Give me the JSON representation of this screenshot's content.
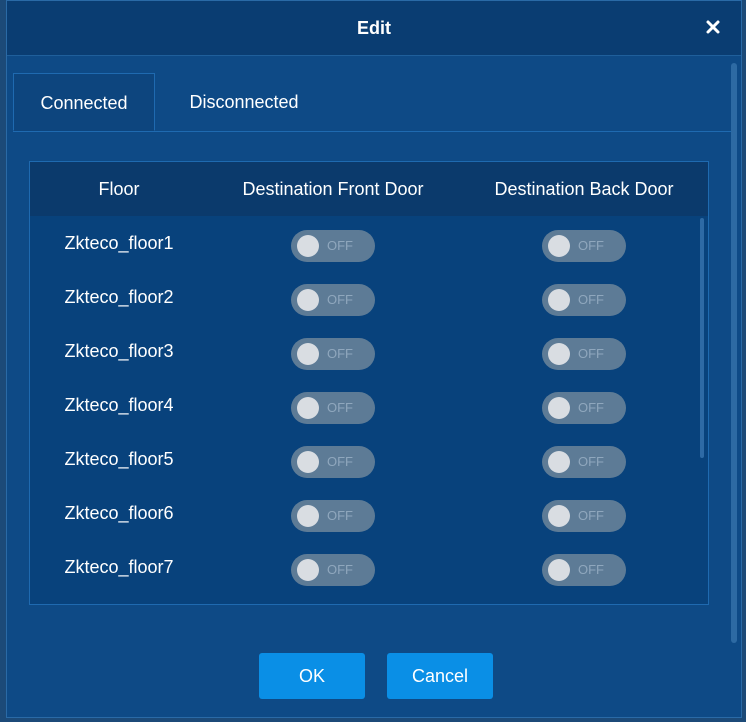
{
  "dialog": {
    "title": "Edit",
    "close_icon": "close-icon"
  },
  "tabs": [
    {
      "label": "Connected",
      "active": true
    },
    {
      "label": "Disconnected",
      "active": false
    }
  ],
  "table": {
    "columns": [
      "Floor",
      "Destination Front Door",
      "Destination Back Door"
    ],
    "rows": [
      {
        "floor": "Zkteco_floor1",
        "front": "OFF",
        "back": "OFF"
      },
      {
        "floor": "Zkteco_floor2",
        "front": "OFF",
        "back": "OFF"
      },
      {
        "floor": "Zkteco_floor3",
        "front": "OFF",
        "back": "OFF"
      },
      {
        "floor": "Zkteco_floor4",
        "front": "OFF",
        "back": "OFF"
      },
      {
        "floor": "Zkteco_floor5",
        "front": "OFF",
        "back": "OFF"
      },
      {
        "floor": "Zkteco_floor6",
        "front": "OFF",
        "back": "OFF"
      },
      {
        "floor": "Zkteco_floor7",
        "front": "OFF",
        "back": "OFF"
      }
    ]
  },
  "buttons": {
    "ok": "OK",
    "cancel": "Cancel"
  },
  "colors": {
    "background": "#0e4a86",
    "accent_button": "#0a8fe6",
    "toggle_off": "#5d7b96"
  }
}
